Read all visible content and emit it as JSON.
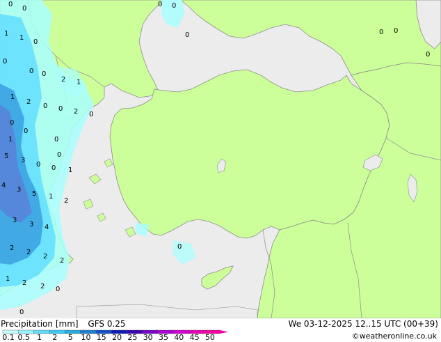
{
  "header": {
    "title": "Precipitation [mm]",
    "model": "GFS 0.25",
    "valid_time": "We 03-12-2025 12..15 UTC (00+39)",
    "credit": "©weatheronline.co.uk"
  },
  "colors": {
    "sea": "#ececec",
    "land": "#ccff99",
    "border": "#8c8c8c",
    "precip_light": "#a8ffff",
    "precip_mid": "#66e0ff",
    "precip_heavy": "#3aa0e0",
    "precip_very_heavy": "#5a80d8"
  },
  "legend": {
    "labels": [
      "0.1",
      "0.5",
      "1",
      "2",
      "5",
      "10",
      "15",
      "20",
      "25",
      "30",
      "35",
      "40",
      "45",
      "50"
    ],
    "colors": [
      "#c8ffff",
      "#96f5ff",
      "#64dcf5",
      "#3cc8f0",
      "#28aadc",
      "#1e82d2",
      "#1450c8",
      "#0a1eb4",
      "#3c00b4",
      "#7800c8",
      "#aa00d2",
      "#d200d2",
      "#e600b4",
      "#f500a0"
    ]
  },
  "precip_values": [
    "0",
    "0",
    "0",
    "0",
    "1",
    "1",
    "0",
    "0",
    "0",
    "0",
    "2",
    "1",
    "1",
    "2",
    "0",
    "0",
    "2",
    "0",
    "0",
    "0",
    "1",
    "0",
    "0",
    "5",
    "3",
    "0",
    "0",
    "1",
    "4",
    "3",
    "5",
    "1",
    "2",
    "3",
    "3",
    "4",
    "2",
    "2",
    "2",
    "2",
    "1",
    "2",
    "2",
    "0",
    "0",
    "0",
    "0",
    "0",
    "0",
    "0"
  ]
}
